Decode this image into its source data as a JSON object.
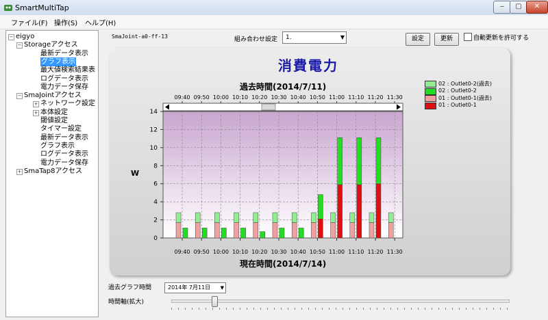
{
  "window": {
    "title": "SmartMultiTap",
    "min_label": "‒",
    "max_label": "▢",
    "close_label": "✕"
  },
  "menu": [
    "ファイル(F)",
    "操作(S)",
    "ヘルプ(H)"
  ],
  "tree": {
    "items": [
      {
        "label": "eigyo",
        "level": 0,
        "expander": "−"
      },
      {
        "label": "Storageアクセス",
        "level": 1,
        "expander": "−"
      },
      {
        "label": "最新データ表示",
        "level": 2
      },
      {
        "label": "グラフ表示",
        "level": 2,
        "selected": true
      },
      {
        "label": "最大値検索結果表",
        "level": 2
      },
      {
        "label": "ログデータ表示",
        "level": 2
      },
      {
        "label": "電力データ保存",
        "level": 2
      },
      {
        "label": "SmaJointアクセス",
        "level": 1,
        "expander": "−"
      },
      {
        "label": "ネットワーク設定",
        "level": 2,
        "expander": "+"
      },
      {
        "label": "本体設定",
        "level": 2,
        "expander": "+"
      },
      {
        "label": "閾値設定",
        "level": 2
      },
      {
        "label": "タイマー設定",
        "level": 2
      },
      {
        "label": "最新データ表示",
        "level": 2
      },
      {
        "label": "グラフ表示",
        "level": 2
      },
      {
        "label": "ログデータ表示",
        "level": 2
      },
      {
        "label": "電力データ保存",
        "level": 2
      },
      {
        "label": "SmaTap8アクセス",
        "level": 1,
        "expander": "+"
      }
    ]
  },
  "toolbar": {
    "device": "SmaJoint-a0-ff-13",
    "combo_label": "組み合わせ設定",
    "combo_value": "1.",
    "settings_button": "設定",
    "update_button": "更新",
    "auto_update_label": "自動更新を許可する"
  },
  "chart_data": {
    "type": "bar",
    "title": "消費電力",
    "top_axis_title": "過去時間(2014/7/11)",
    "xlabel": "現在時間(2014/7/14)",
    "ylabel": "W",
    "ylim": [
      0,
      14
    ],
    "yticks": [
      0,
      2,
      4,
      6,
      8,
      10,
      12,
      14
    ],
    "tick_labels": [
      "09:40",
      "09:50",
      "10:00",
      "10:10",
      "10:20",
      "10:30",
      "10:40",
      "10:50",
      "11:00",
      "11:10",
      "11:20",
      "11:30"
    ],
    "grid": true,
    "legend_position": "right",
    "series": [
      {
        "name": "02 : Outlet0-2(過去)",
        "color": "#90ee90",
        "values": [
          1.1,
          1.1,
          1.1,
          1.1,
          1.1,
          1.1,
          1.1,
          1.1,
          1.1,
          1.1,
          1.1,
          1.1
        ]
      },
      {
        "name": "02 : Outlet0-2",
        "color": "#22dd22",
        "values": [
          1.1,
          1.1,
          1.1,
          1.1,
          0.7,
          1.1,
          1.1,
          2.7,
          5.2,
          5.2,
          5.1,
          0
        ]
      },
      {
        "name": "01 : Outlet0-1(過去)",
        "color": "#f0a0a0",
        "values": [
          1.7,
          1.7,
          1.7,
          1.7,
          1.7,
          1.7,
          1.7,
          1.7,
          1.7,
          1.7,
          1.7,
          1.7
        ]
      },
      {
        "name": "01 : Outlet0-1",
        "color": "#dd1111",
        "values": [
          0,
          0,
          0,
          0,
          0,
          0,
          0,
          2.1,
          5.9,
          5.9,
          6.0,
          0
        ]
      }
    ]
  },
  "bottom": {
    "past_graph_label": "過去グラフ時間",
    "date_value": "2014年  7月11日",
    "zoom_label": "時間軸(拡大)",
    "zoom_level": 0.12
  }
}
